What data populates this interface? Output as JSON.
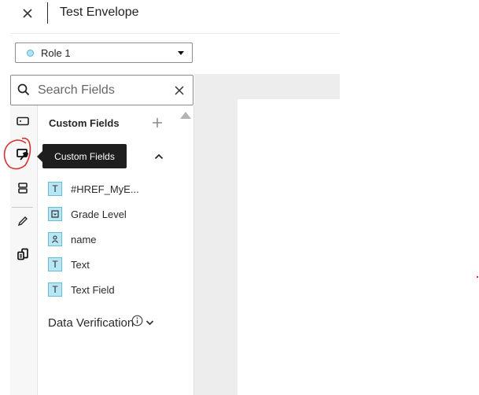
{
  "header": {
    "title": "Test Envelope"
  },
  "role_select": {
    "selected": "Role 1",
    "dot_color": "#aee4f5"
  },
  "search": {
    "placeholder": "Search Fields",
    "value": ""
  },
  "rail": {
    "items": [
      {
        "icon": "standard-fields-icon",
        "active": false
      },
      {
        "icon": "custom-fields-icon",
        "active": true
      },
      {
        "icon": "merge-fields-icon",
        "active": false
      },
      {
        "icon": "pencil-icon",
        "active": false
      },
      {
        "icon": "templates-icon",
        "active": false
      }
    ]
  },
  "tooltip": {
    "text": "Custom Fields"
  },
  "panel": {
    "section_title": "Custom Fields",
    "fields": [
      {
        "icon": "text-field-icon",
        "glyph": "T",
        "label": "#HREF_MyE..."
      },
      {
        "icon": "dropdown-field-icon",
        "glyph": "",
        "label": "Grade Level"
      },
      {
        "icon": "person-field-icon",
        "glyph": "",
        "label": "name"
      },
      {
        "icon": "text-field-icon",
        "glyph": "T",
        "label": "Text"
      },
      {
        "icon": "text-field-icon",
        "glyph": "T",
        "label": "Text Field"
      }
    ],
    "data_verification": {
      "label": "Data Verification"
    }
  },
  "colors": {
    "accent": "#b7e6f5",
    "annotation": "#d9302c",
    "tooltip_bg": "#1e1e1e"
  }
}
